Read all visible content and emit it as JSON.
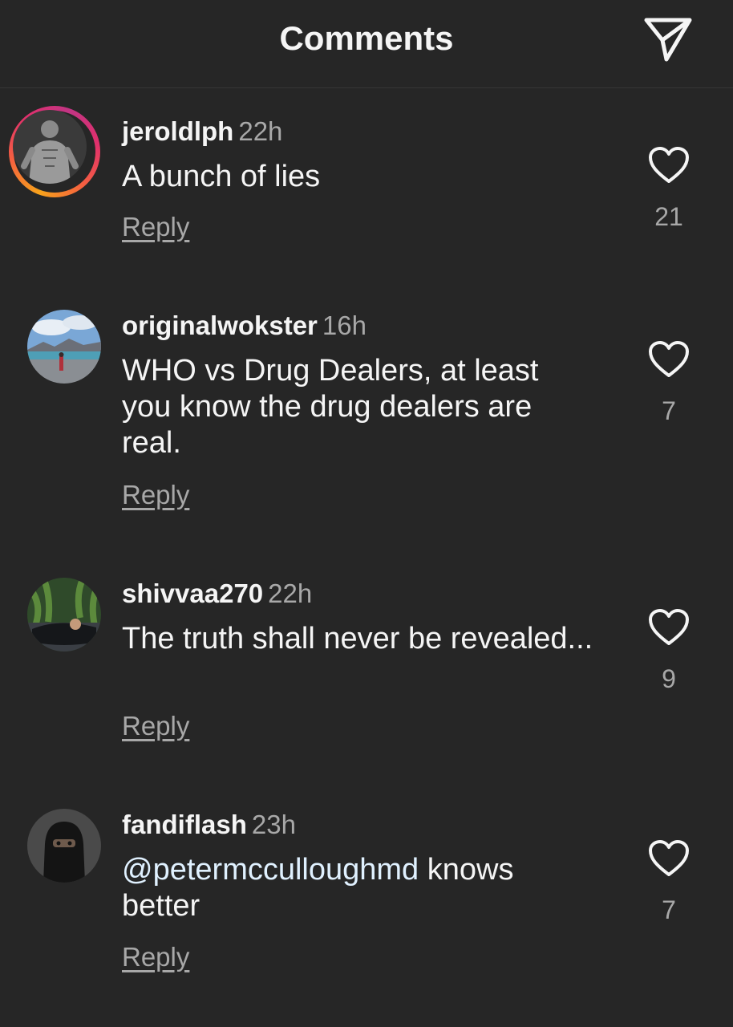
{
  "header": {
    "title": "Comments",
    "share_icon": "paper-plane-icon"
  },
  "comments": [
    {
      "username": "jeroldlph",
      "time": "22h",
      "text": "A bunch of lies",
      "reply_label": "Reply",
      "likes": "21",
      "has_story_ring": true
    },
    {
      "username": "originalwokster",
      "time": "16h",
      "text": "WHO vs Drug Dealers, at least you know the drug dealers are real.",
      "reply_label": "Reply",
      "likes": "7",
      "has_story_ring": false
    },
    {
      "username": "shivvaa270",
      "time": "22h",
      "text": "The truth shall never be revealed...",
      "reply_label": "Reply",
      "likes": "9",
      "has_story_ring": false
    },
    {
      "username": "fandiflash",
      "time": "23h",
      "mention": "@petermcculloughmd",
      "text": " knows better",
      "reply_label": "Reply",
      "likes": "7",
      "has_story_ring": false
    }
  ],
  "colors": {
    "background": "#262626",
    "text": "#f5f5f5",
    "secondary": "#a8a8a8",
    "mention": "#e0f1ff",
    "story_ring_start": "#f7a21b",
    "story_ring_end": "#c13584"
  }
}
